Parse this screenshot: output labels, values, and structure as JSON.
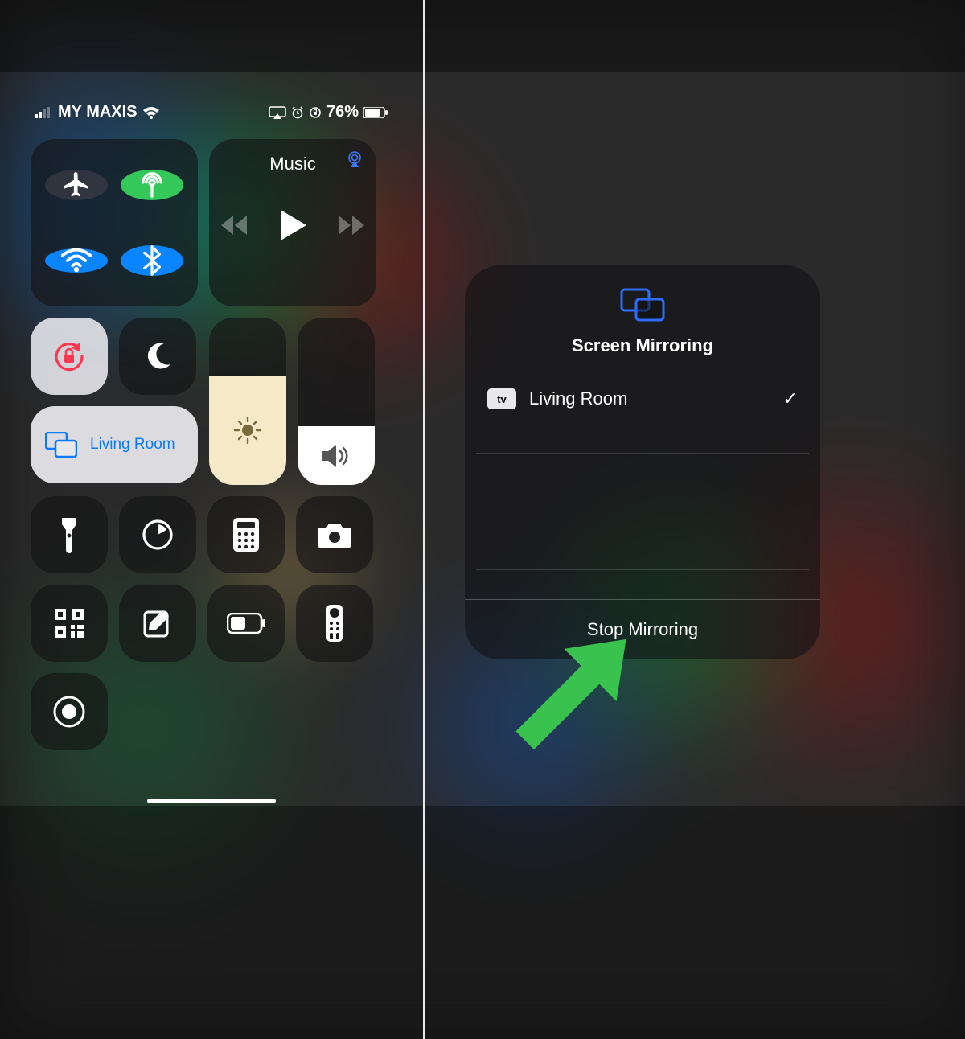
{
  "status": {
    "carrier": "MY MAXIS",
    "battery_pct": "76%"
  },
  "connectivity": {
    "airplane": "off",
    "cellular": "on",
    "wifi": "on",
    "bluetooth": "on"
  },
  "media": {
    "title": "Music"
  },
  "mirror_tile": {
    "label": "Living Room"
  },
  "sliders": {
    "brightness_pct": 65,
    "volume_pct": 35
  },
  "utility_buttons": [
    "flashlight",
    "timer",
    "calculator",
    "camera",
    "qr-scanner",
    "notes",
    "low-power",
    "apple-tv-remote",
    "screen-record"
  ],
  "popup": {
    "title": "Screen Mirroring",
    "device": {
      "badge": "tv",
      "name": "Living Room",
      "selected": true
    },
    "footer": "Stop Mirroring"
  },
  "colors": {
    "blue": "#0a84ff",
    "green": "#34c759",
    "arrow": "#39c24d"
  }
}
